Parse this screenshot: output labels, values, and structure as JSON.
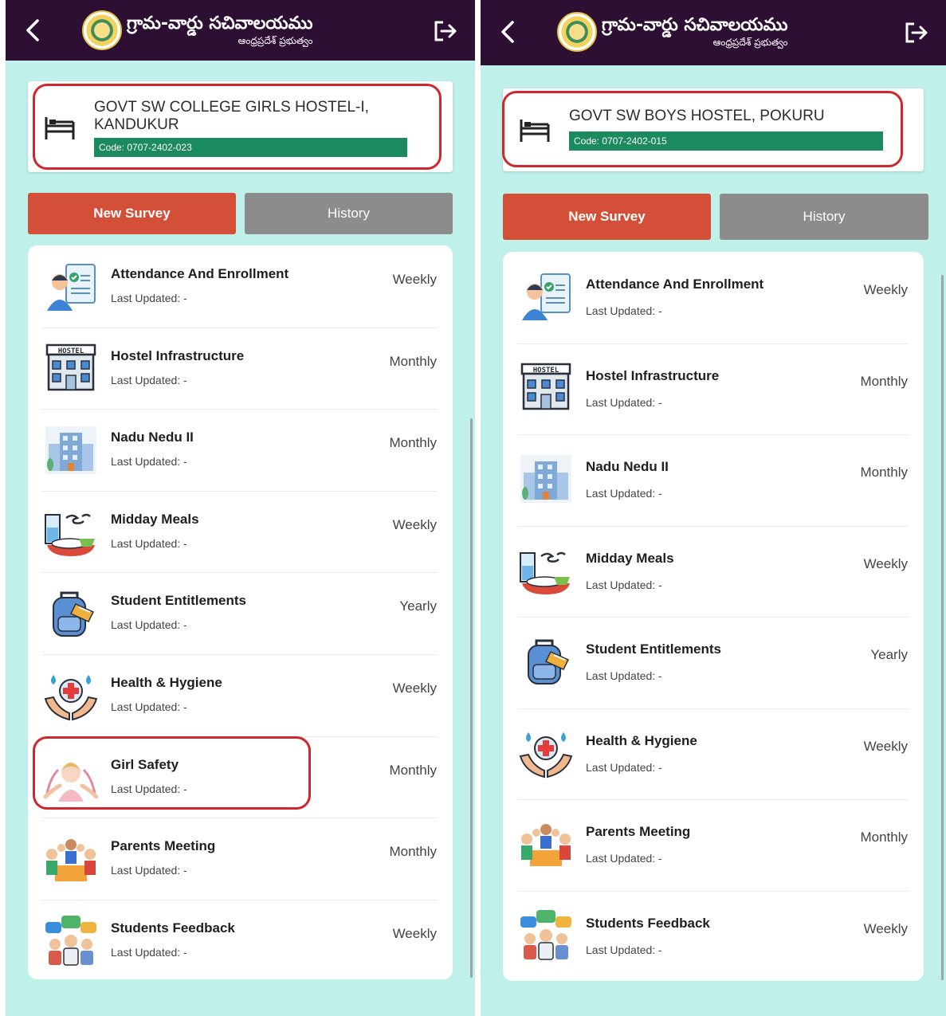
{
  "app": {
    "title": "గ్రామ-వార్డు సచివాలయము",
    "subtitle": "ఆంధ్రప్రదేశ్ ప్రభుత్వం",
    "colors": {
      "topbar": "#2c0f33",
      "accent_red": "#d44f38",
      "code_green": "#1c8a5f",
      "background": "#bff0ea",
      "highlight": "#d0262d"
    }
  },
  "tabs": {
    "new_survey": "New Survey",
    "history": "History"
  },
  "left": {
    "hostel_name_line1": "GOVT SW COLLEGE GIRLS HOSTEL-I,",
    "hostel_name_line2": "KANDUKUR",
    "code": "Code: 0707-2402-023",
    "items": [
      {
        "title": "Attendance And Enrollment",
        "sub": "Last Updated: -",
        "freq": "Weekly",
        "icon": "attendance-icon"
      },
      {
        "title": "Hostel Infrastructure",
        "sub": "Last Updated: -",
        "freq": "Monthly",
        "icon": "hostel-building-icon"
      },
      {
        "title": "Nadu Nedu II",
        "sub": "Last Updated: -",
        "freq": "Monthly",
        "icon": "office-building-icon"
      },
      {
        "title": "Midday Meals",
        "sub": "Last Updated: -",
        "freq": "Weekly",
        "icon": "meal-icon"
      },
      {
        "title": "Student Entitlements",
        "sub": "Last Updated: -",
        "freq": "Yearly",
        "icon": "backpack-icon"
      },
      {
        "title": "Health & Hygiene",
        "sub": "Last Updated: -",
        "freq": "Weekly",
        "icon": "health-hands-icon"
      },
      {
        "title": "Girl Safety",
        "sub": "Last Updated: -",
        "freq": "Monthly",
        "icon": "girl-safety-icon"
      },
      {
        "title": "Parents Meeting",
        "sub": "Last Updated: -",
        "freq": "Monthly",
        "icon": "parents-meeting-icon"
      },
      {
        "title": "Students Feedback",
        "sub": "Last Updated: -",
        "freq": "Weekly",
        "icon": "feedback-icon"
      }
    ]
  },
  "right": {
    "hostel_name_line1": "GOVT SW BOYS HOSTEL, POKURU",
    "code": "Code: 0707-2402-015",
    "items": [
      {
        "title": "Attendance And Enrollment",
        "sub": "Last Updated: -",
        "freq": "Weekly",
        "icon": "attendance-icon"
      },
      {
        "title": "Hostel Infrastructure",
        "sub": "Last Updated: -",
        "freq": "Monthly",
        "icon": "hostel-building-icon"
      },
      {
        "title": "Nadu Nedu II",
        "sub": "Last Updated: -",
        "freq": "Monthly",
        "icon": "office-building-icon"
      },
      {
        "title": "Midday Meals",
        "sub": "Last Updated: -",
        "freq": "Weekly",
        "icon": "meal-icon"
      },
      {
        "title": "Student Entitlements",
        "sub": "Last Updated: -",
        "freq": "Yearly",
        "icon": "backpack-icon"
      },
      {
        "title": "Health & Hygiene",
        "sub": "Last Updated: -",
        "freq": "Weekly",
        "icon": "health-hands-icon"
      },
      {
        "title": "Parents Meeting",
        "sub": "Last Updated: -",
        "freq": "Monthly",
        "icon": "parents-meeting-icon"
      },
      {
        "title": "Students Feedback",
        "sub": "Last Updated: -",
        "freq": "Weekly",
        "icon": "feedback-icon"
      }
    ]
  }
}
